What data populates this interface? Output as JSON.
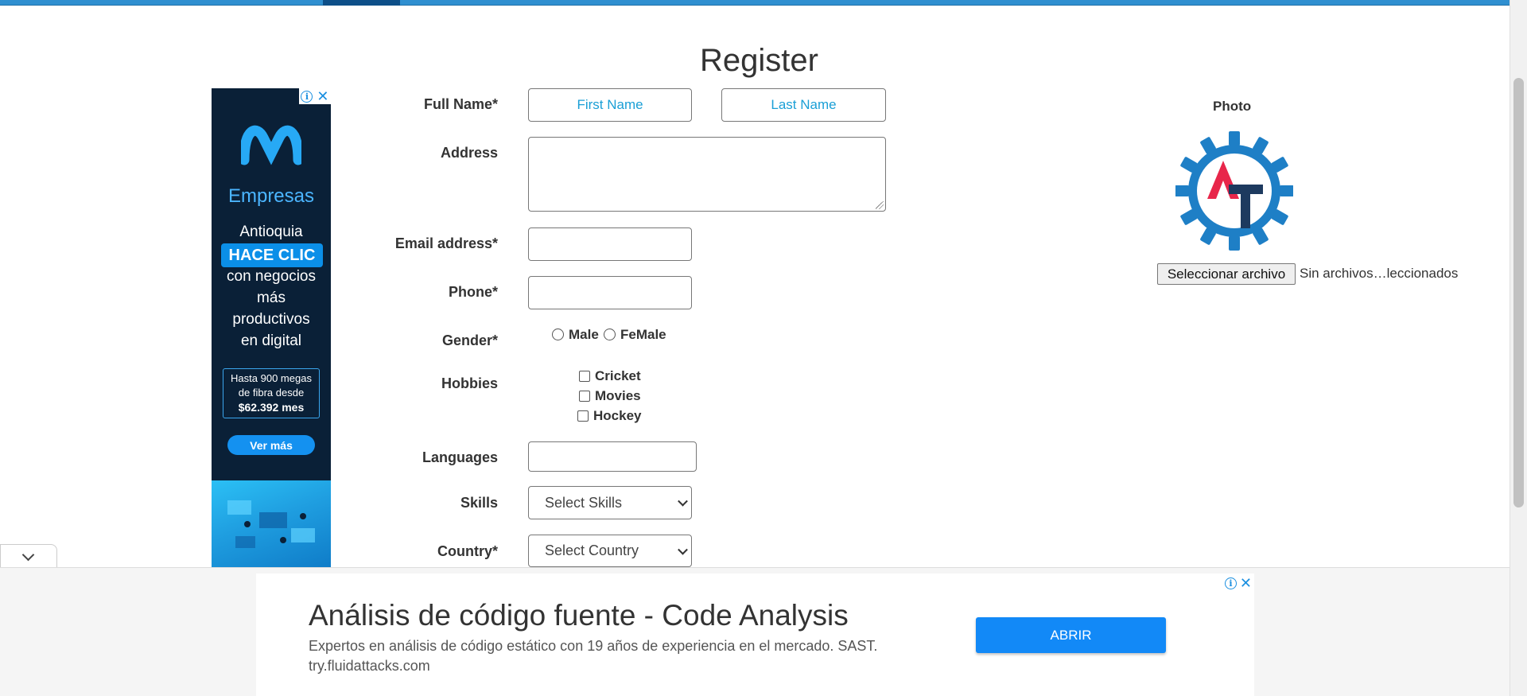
{
  "page": {
    "title": "Register"
  },
  "form": {
    "full_name_label": "Full Name*",
    "first_name_placeholder": "First Name",
    "last_name_placeholder": "Last Name",
    "address_label": "Address",
    "email_label": "Email address*",
    "phone_label": "Phone*",
    "gender_label": "Gender*",
    "gender_options": [
      "Male",
      "FeMale"
    ],
    "hobbies_label": "Hobbies",
    "hobbies": [
      "Cricket",
      "Movies",
      "Hockey"
    ],
    "languages_label": "Languages",
    "skills_label": "Skills",
    "skills_selected": "Select Skills",
    "country_label": "Country*",
    "country_selected": "Select Country"
  },
  "photo": {
    "title": "Photo",
    "choose_button": "Seleccionar archivo",
    "file_status": "Sin archivos…leccionados"
  },
  "side_ad": {
    "brand": "Empresas",
    "lines": [
      "Antioquia",
      "con negocios",
      "más",
      "productivos",
      "en digital"
    ],
    "highlight": "HACE CLIC",
    "offer_lines": [
      "Hasta 900 megas",
      "de fibra desde"
    ],
    "offer_price": "$62.392 mes",
    "cta": "Ver más"
  },
  "bottom_ad": {
    "headline": "Análisis de código fuente - Code Analysis",
    "description": "Expertos en análisis de código estático con 19 años de experiencia en el mercado. SAST.",
    "domain": "try.fluidattacks.com",
    "cta": "ABRIR"
  },
  "icons": {
    "ad_info": "info-icon",
    "ad_close": "close-icon",
    "collapse": "chevron-down-icon",
    "select_arrow": "chevron-down-icon",
    "logo": "gear-logo-icon"
  },
  "colors": {
    "top_bar": "#2f8fd0",
    "placeholder": "#1a9fd6",
    "cta_blue": "#1289f7",
    "ad_background": "#0a2037"
  }
}
